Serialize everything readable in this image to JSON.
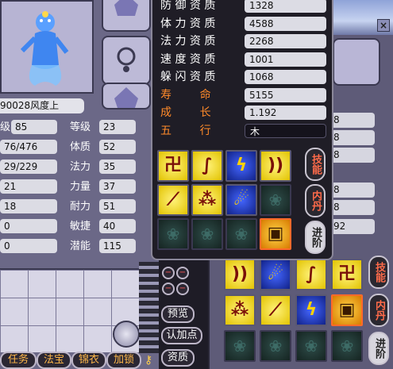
{
  "back_window": {
    "values": [
      "8",
      "8",
      "8",
      "8",
      "8",
      "92"
    ],
    "side_buttons": [
      "技能",
      "内丹",
      "进阶"
    ]
  },
  "left_window": {
    "pet_name": "90028风度上",
    "stats": [
      {
        "left_label": "级",
        "left_value": "85",
        "right_label": "等级",
        "right_value": "23"
      },
      {
        "left_label": "",
        "left_value": "76/476",
        "right_label": "体质",
        "right_value": "52"
      },
      {
        "left_label": "",
        "left_value": "29/229",
        "right_label": "法力",
        "right_value": "35"
      },
      {
        "left_label": "",
        "left_value": "21",
        "right_label": "力量",
        "right_value": "37"
      },
      {
        "left_label": "",
        "left_value": "18",
        "right_label": "耐力",
        "right_value": "51"
      },
      {
        "left_label": "",
        "left_value": "0",
        "right_label": "敏捷",
        "right_value": "40"
      },
      {
        "left_label": "",
        "left_value": "0",
        "right_label": "潜能",
        "right_value": "115"
      }
    ],
    "bottom_buttons": [
      "任务",
      "法宝",
      "锦衣",
      "加锁"
    ]
  },
  "middle": {
    "buttons": [
      "预览",
      "认加点",
      "资质"
    ]
  },
  "aptitude_panel": {
    "rows": [
      {
        "label": "防 御 资 质",
        "value": "1328",
        "style": "white"
      },
      {
        "label": "体 力 资 质",
        "value": "4588",
        "style": "white"
      },
      {
        "label": "法 力 资 质",
        "value": "2268",
        "style": "white"
      },
      {
        "label": "速 度 资 质",
        "value": "1001",
        "style": "white"
      },
      {
        "label": "躲 闪 资 质",
        "value": "1068",
        "style": "white"
      },
      {
        "label": "寿        命",
        "value": "5155",
        "style": "orange"
      },
      {
        "label": "成        长",
        "value": "1.192",
        "style": "orange"
      },
      {
        "label": "五        行",
        "value": "木",
        "style": "orange"
      }
    ],
    "skills": [
      {
        "icon": "fist-skill-icon",
        "glyph": "卍",
        "kind": "yellow"
      },
      {
        "icon": "claw-skill-icon",
        "glyph": "∫",
        "kind": "yellow"
      },
      {
        "icon": "lightning-skill-icon",
        "glyph": "ϟ",
        "kind": "blue"
      },
      {
        "icon": "wave-skill-icon",
        "glyph": "))",
        "kind": "yellow"
      },
      {
        "icon": "slash-skill-icon",
        "glyph": "⟋",
        "kind": "yellow"
      },
      {
        "icon": "dots-skill-icon",
        "glyph": "⁂",
        "kind": "yellow"
      },
      {
        "icon": "water-skill-icon",
        "glyph": "☄",
        "kind": "blue"
      },
      {
        "icon": "empty-slot-icon",
        "glyph": "❀",
        "kind": "empty"
      },
      {
        "icon": "empty-slot-icon",
        "glyph": "❀",
        "kind": "empty"
      },
      {
        "icon": "empty-slot-icon",
        "glyph": "❀",
        "kind": "empty"
      },
      {
        "icon": "empty-slot-icon",
        "glyph": "❀",
        "kind": "empty"
      },
      {
        "icon": "special-skill-icon",
        "glyph": "▣",
        "kind": "selected"
      }
    ],
    "side_buttons": [
      "技能",
      "内丹",
      "进阶"
    ]
  },
  "back_skills": [
    {
      "icon": "wave-skill-icon",
      "glyph": "))",
      "kind": "yellow"
    },
    {
      "icon": "water-skill-icon",
      "glyph": "☄",
      "kind": "blue"
    },
    {
      "icon": "claw-skill-icon",
      "glyph": "∫",
      "kind": "yellow"
    },
    {
      "icon": "fist-skill-icon",
      "glyph": "卍",
      "kind": "yellow"
    },
    {
      "icon": "dots-skill-icon",
      "glyph": "⁂",
      "kind": "yellow"
    },
    {
      "icon": "slash-skill-icon",
      "glyph": "⟋",
      "kind": "yellow"
    },
    {
      "icon": "lightning-skill-icon",
      "glyph": "ϟ",
      "kind": "blue"
    },
    {
      "icon": "special-skill-icon",
      "glyph": "▣",
      "kind": "selected"
    },
    {
      "icon": "empty-slot-icon",
      "glyph": "❀",
      "kind": "empty"
    },
    {
      "icon": "empty-slot-icon",
      "glyph": "❀",
      "kind": "empty"
    },
    {
      "icon": "empty-slot-icon",
      "glyph": "❀",
      "kind": "empty"
    },
    {
      "icon": "empty-slot-icon",
      "glyph": "❀",
      "kind": "empty"
    }
  ]
}
